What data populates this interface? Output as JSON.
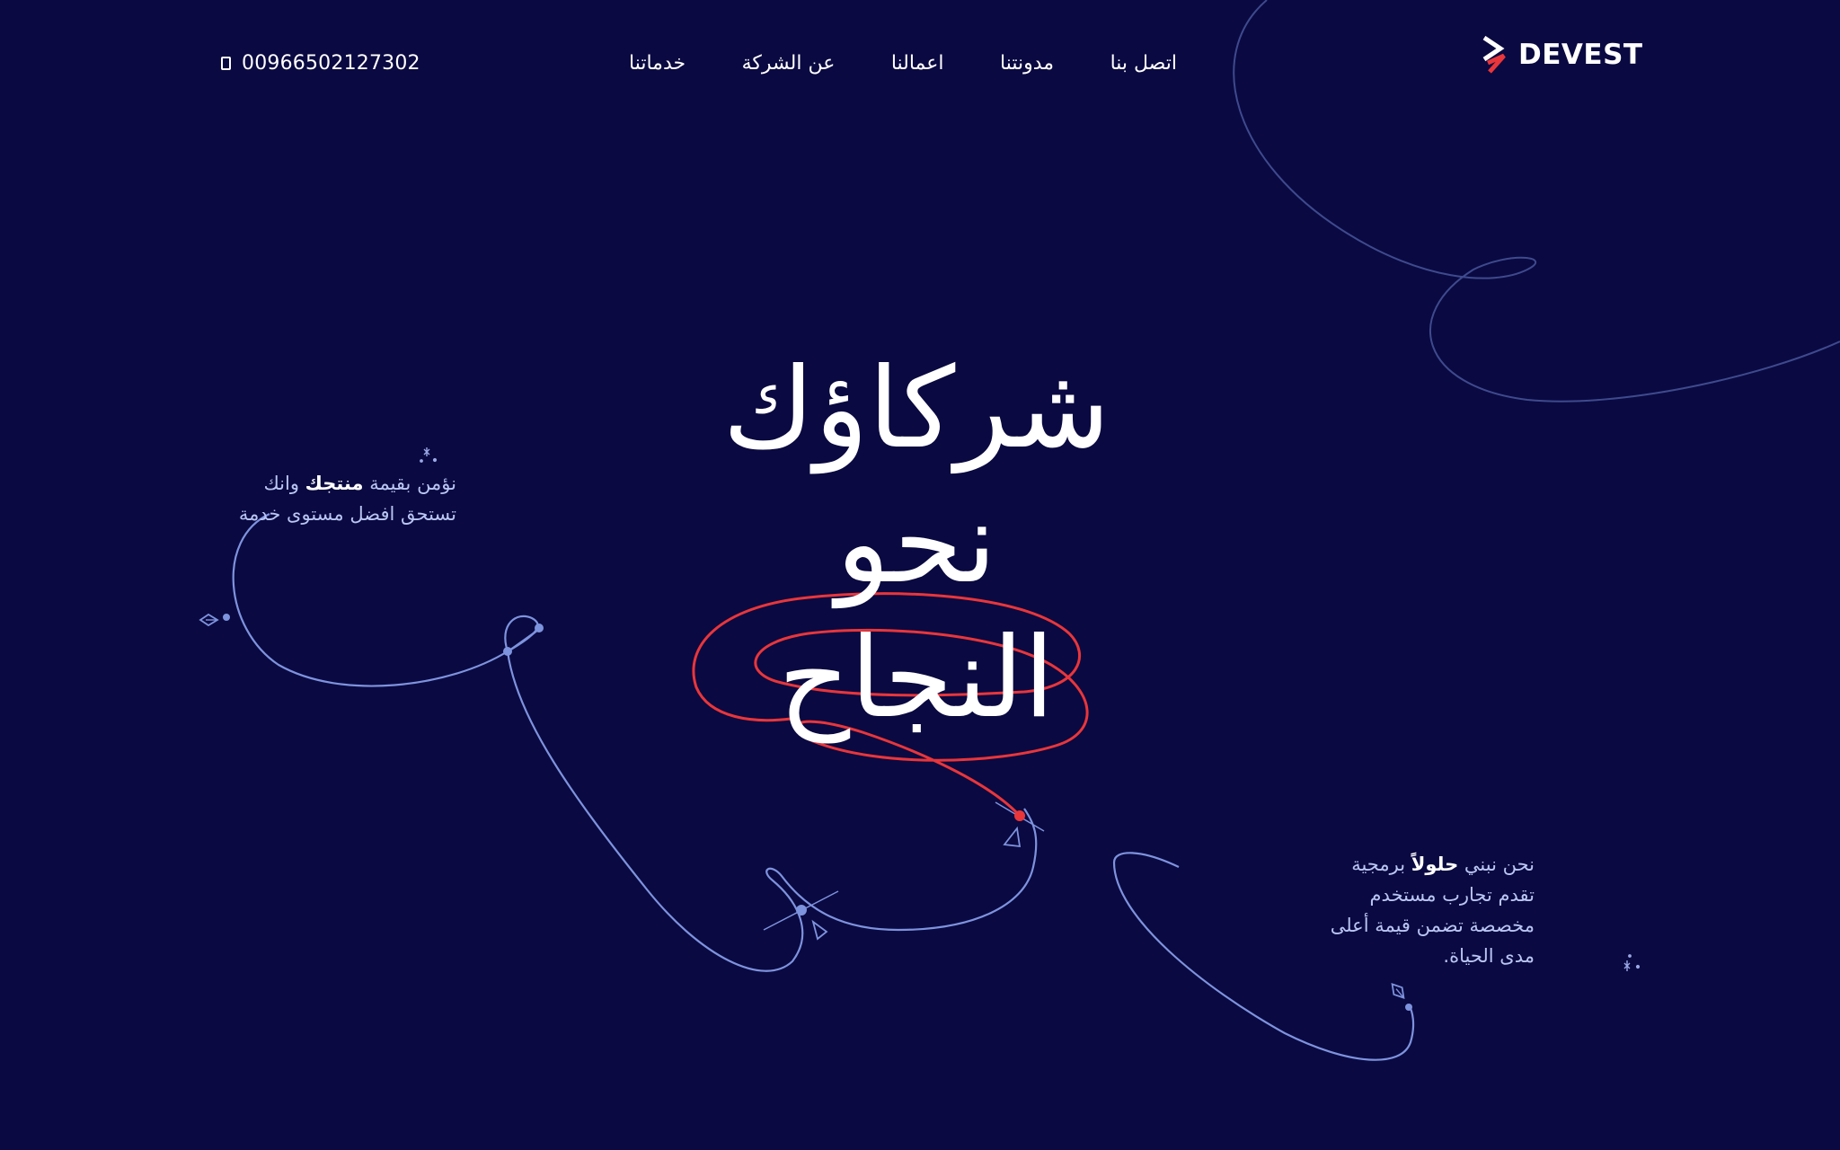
{
  "header": {
    "logo_text": "DEVEST",
    "nav": [
      {
        "label": "خدماتنا"
      },
      {
        "label": "عن الشركة"
      },
      {
        "label": "اعمالنا"
      },
      {
        "label": "مدونتنا"
      },
      {
        "label": "اتصل بنا"
      }
    ],
    "phone": "00966502127302",
    "phone_icon": "phone-icon"
  },
  "hero": {
    "lines": [
      "شركاؤك",
      "نحو",
      "النجاح"
    ]
  },
  "blurb_left": {
    "line1_pre": "نؤمن بقيمة ",
    "line1_bold": "منتجك",
    "line1_post": " وانك",
    "line2": "تستحق افضل مستوى خدمة"
  },
  "blurb_right": {
    "line1_pre": "نحن نبني ",
    "line1_bold": "حلولاً",
    "line1_post": " برمجية",
    "line2": "تقدم تجارب مستخدم",
    "line3": "مخصصة تضمن قيمة أعلى",
    "line4": "مدى الحياة."
  },
  "colors": {
    "background": "#0a0941",
    "curve_blue": "#7e93de",
    "curve_red": "#e8363b",
    "curve_faint": "#3e4a8e",
    "text": "#ffffff",
    "blurb": "#b9c5f3"
  }
}
